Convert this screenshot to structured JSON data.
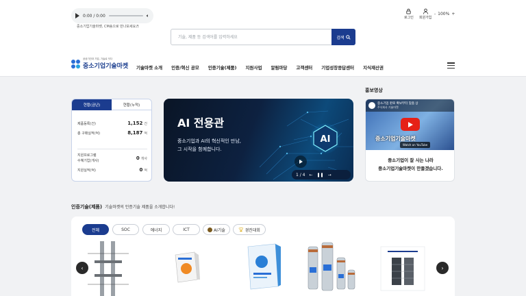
{
  "audio": {
    "time": "0:00 / 0:00",
    "note": "중소기업기술마켓, CM송으로 만나보세요♬"
  },
  "search": {
    "placeholder": "기술, 제품 등 검색어를 입력하세요",
    "button": "검색"
  },
  "utility": {
    "login": "로그인",
    "signup": "회원가입",
    "zoom_minus": "-",
    "zoom": "100%",
    "zoom_plus": "+"
  },
  "logo": {
    "tagline": "공공기관과 기업, 기술로 잇다",
    "name": "중소기업기술마켓"
  },
  "nav": [
    "기술마켓 소개",
    "인증/혁신 공모",
    "인증기술(제품)",
    "지원사업",
    "알림마당",
    "고객센터",
    "기업성장응답센터",
    "지식재산권"
  ],
  "stats": {
    "tab_current": "현황(금년)",
    "tab_total": "현황(누적)",
    "rows": [
      {
        "label": "제품등록(건)",
        "value": "1,152",
        "unit": "건"
      },
      {
        "label": "총 구매실적(억)",
        "value": "8,187",
        "unit": "억"
      },
      {
        "label": "지원프로그램\n수혜기업(개사)",
        "value": "0",
        "unit": "개사"
      },
      {
        "label": "지원실적(억)",
        "value": "0",
        "unit": "억"
      }
    ]
  },
  "banner": {
    "title": "AI 전용관",
    "line1": "중소기업과 AI의 혁신적인 만남,",
    "line2": "그 시작을 함께합니다.",
    "chip": "AI",
    "page": "1 / 4"
  },
  "promo": {
    "heading": "홍보영상",
    "video_title": "중소기업 판로 확보부터 맞춤 상",
    "video_channel": "주식회사 기술마켓",
    "video_caption": "중소기업기술마켓",
    "watch": "Watch on YouTube",
    "line1": "중소기업이 잘 사는 나라",
    "line2": "중소기업기술마켓이 만들겠습니다."
  },
  "section": {
    "title": "인증기술(제품)",
    "subtitle": "기술마켓의 인증기술 제품을 소개합니다!"
  },
  "categories": [
    "전체",
    "SOC",
    "에너지",
    "ICT",
    "AI기술",
    "경진대회"
  ],
  "colors": {
    "primary": "#1b3c8f",
    "youtube": "#e62117"
  }
}
